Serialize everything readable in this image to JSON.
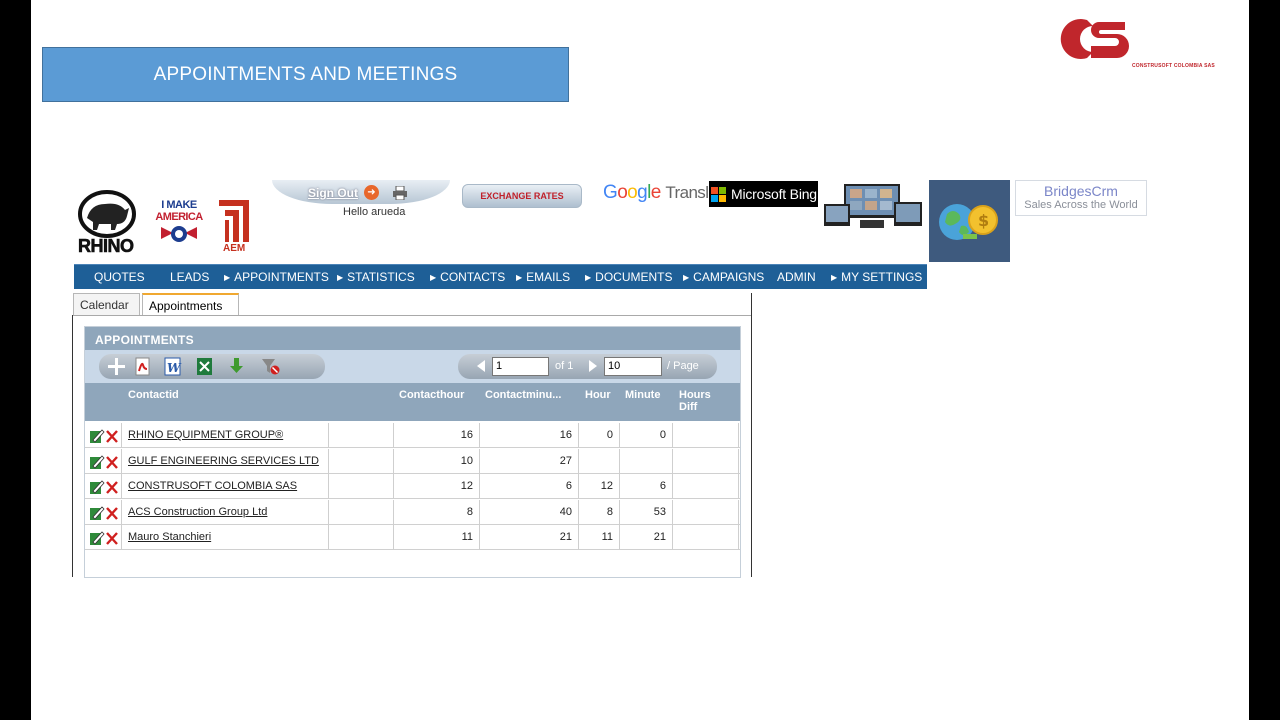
{
  "slide": {
    "title": "APPOINTMENTS AND MEETINGS",
    "company_logo_text": "CS",
    "company_name": "CONSTRUSOFT COLOMBIA SAS"
  },
  "header": {
    "rhino_label": "RHINO",
    "imake_line1": "I MAKE",
    "imake_line2": "AMERICA",
    "aem_label": "AEM",
    "sign_out": "Sign Out",
    "greeting": "Hello arueda",
    "exchange_rates": "EXCHANGE RATES",
    "google_translate_g": "Google",
    "google_translate_t": "Translate",
    "microsoft_bing": "Microsoft Bing",
    "bridges_title": "BridgesCrm",
    "bridges_tagline": "Sales Across the World"
  },
  "nav": {
    "items": [
      {
        "label": "QUOTES",
        "arrow": false
      },
      {
        "label": "LEADS",
        "arrow": false
      },
      {
        "label": "APPOINTMENTS",
        "arrow": true
      },
      {
        "label": "STATISTICS",
        "arrow": true
      },
      {
        "label": "CONTACTS",
        "arrow": true
      },
      {
        "label": "EMAILS",
        "arrow": true
      },
      {
        "label": "DOCUMENTS",
        "arrow": true
      },
      {
        "label": "CAMPAIGNS",
        "arrow": true
      },
      {
        "label": "ADMIN",
        "arrow": false
      },
      {
        "label": "MY SETTINGS",
        "arrow": true
      }
    ]
  },
  "tabs": {
    "calendar": "Calendar",
    "appointments": "Appointments",
    "active": "appointments"
  },
  "grid": {
    "title": "APPOINTMENTS",
    "pager": {
      "page": "1",
      "of_text": "of 1",
      "page_size": "10",
      "per_page": "/ Page"
    },
    "columns": {
      "contactid": "Contactid",
      "contacthour": "Contacthour",
      "contactminute": "Contactminu...",
      "hour": "Hour",
      "minute": "Minute",
      "hours_diff_1": "Hours",
      "hours_diff_2": "Diff"
    },
    "rows": [
      {
        "contact": "RHINO EQUIPMENT GROUP®",
        "blank": "",
        "contacthour": "16",
        "contactminute": "16",
        "hour": "0",
        "minute": "0",
        "hours_diff": ""
      },
      {
        "contact": "GULF ENGINEERING SERVICES LTD",
        "blank": "",
        "contacthour": "10",
        "contactminute": "27",
        "hour": "",
        "minute": "",
        "hours_diff": ""
      },
      {
        "contact": "CONSTRUSOFT COLOMBIA SAS",
        "blank": "",
        "contacthour": "12",
        "contactminute": "6",
        "hour": "12",
        "minute": "6",
        "hours_diff": ""
      },
      {
        "contact": "ACS Construction Group Ltd",
        "blank": "",
        "contacthour": "8",
        "contactminute": "40",
        "hour": "8",
        "minute": "53",
        "hours_diff": ""
      },
      {
        "contact": "Mauro Stanchieri",
        "blank": "",
        "contacthour": "11",
        "contactminute": "21",
        "hour": "11",
        "minute": "21",
        "hours_diff": ""
      }
    ]
  },
  "colors": {
    "banner": "#5b9bd5",
    "nav": "#1e5f97",
    "grid_header": "#8fa6bb",
    "toolbar": "#c9d8e8",
    "brand_red": "#c0262c"
  }
}
